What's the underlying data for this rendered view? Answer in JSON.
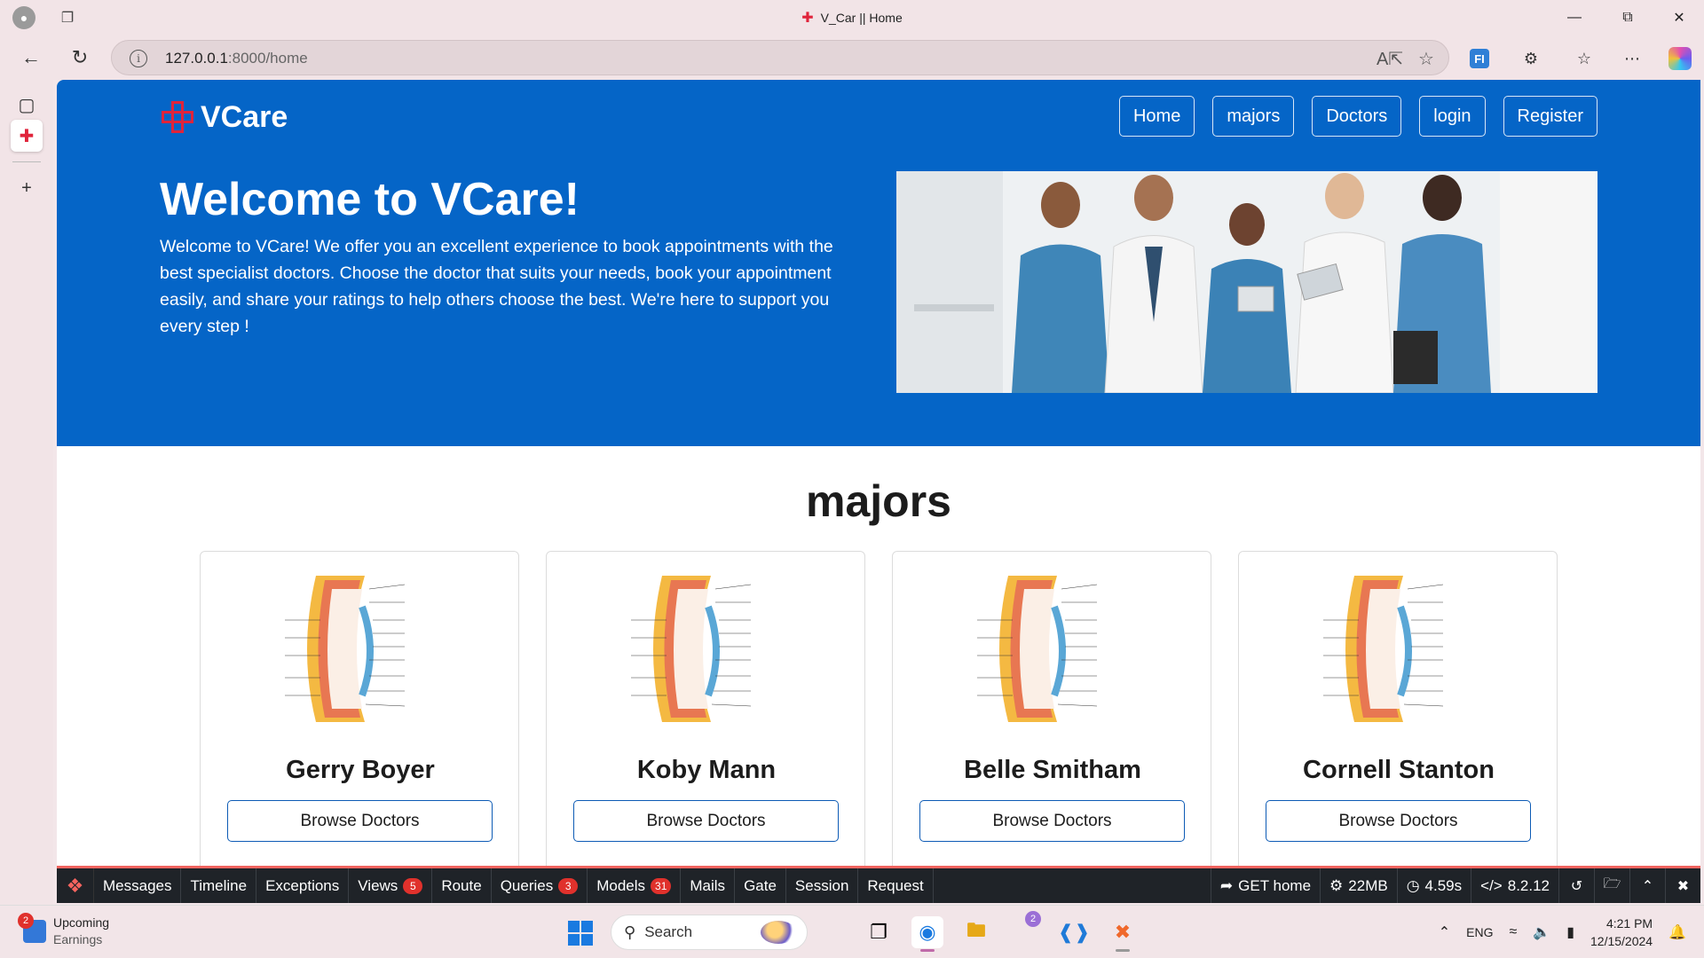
{
  "browser": {
    "tab_title": "V_Car || Home",
    "url_host": "127.0.0.1",
    "url_path": ":8000/home"
  },
  "site": {
    "brand": "VCare",
    "nav": [
      "Home",
      "majors",
      "Doctors",
      "login",
      "Register"
    ],
    "hero_title": "Welcome to VCare!",
    "hero_text": "Welcome to VCare! We offer you an excellent experience to book appointments with the best specialist doctors. Choose the doctor that suits your needs, book your appointment easily, and share your ratings to help others choose the best. We're here to support you every step !",
    "brand_color": "#0565c7",
    "accent_color": "#e0243b"
  },
  "majors": {
    "title": "majors",
    "cards": [
      {
        "name": "Gerry Boyer",
        "button": "Browse Doctors"
      },
      {
        "name": "Koby Mann",
        "button": "Browse Doctors"
      },
      {
        "name": "Belle Smitham",
        "button": "Browse Doctors"
      },
      {
        "name": "Cornell Stanton",
        "button": "Browse Doctors"
      }
    ]
  },
  "debugbar": {
    "tabs": [
      {
        "label": "Messages"
      },
      {
        "label": "Timeline"
      },
      {
        "label": "Exceptions"
      },
      {
        "label": "Views",
        "badge": "5"
      },
      {
        "label": "Route"
      },
      {
        "label": "Queries",
        "badge": "3"
      },
      {
        "label": "Models",
        "badge": "31"
      },
      {
        "label": "Mails"
      },
      {
        "label": "Gate"
      },
      {
        "label": "Session"
      },
      {
        "label": "Request"
      }
    ],
    "route": "GET home",
    "memory": "22MB",
    "time": "4.59s",
    "php_version": "8.2.12"
  },
  "taskbar": {
    "weather_title": "Upcoming",
    "weather_sub": "Earnings",
    "weather_badge": "2",
    "search_placeholder": "Search",
    "app_badge": "2",
    "language": "ENG",
    "time": "4:21 PM",
    "date": "12/15/2024"
  }
}
